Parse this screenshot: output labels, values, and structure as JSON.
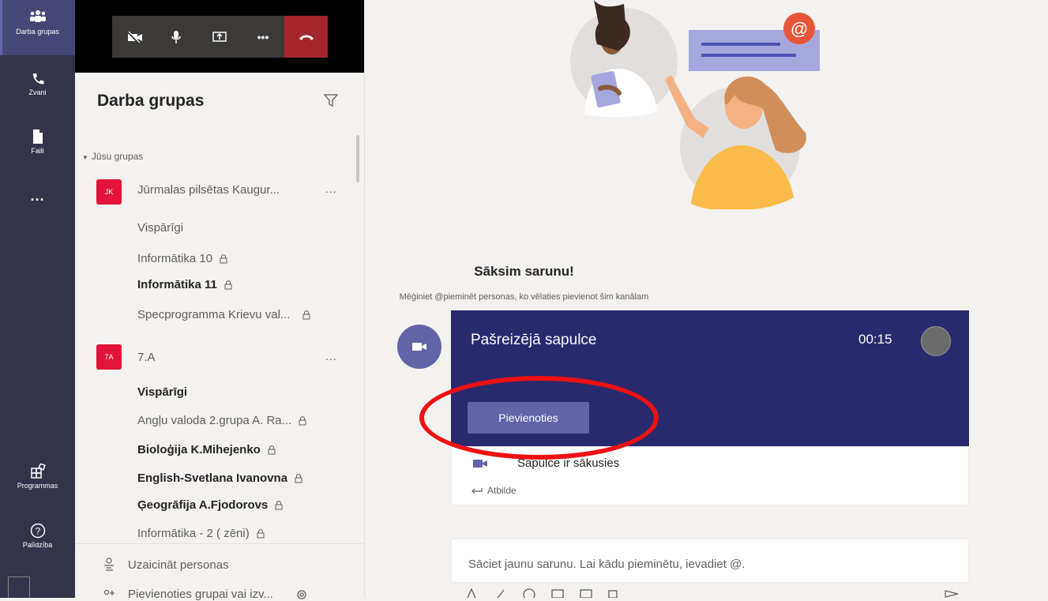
{
  "rail": {
    "items": [
      {
        "label": "Darba grupas",
        "icon": "teams-icon"
      },
      {
        "label": "Zvani",
        "icon": "phone-icon"
      },
      {
        "label": "Faili",
        "icon": "file-icon"
      },
      {
        "label": "...",
        "icon": "more-icon"
      },
      {
        "label": "Programmas",
        "icon": "apps-icon"
      },
      {
        "label": "Palīdzība",
        "icon": "help-icon"
      }
    ]
  },
  "panel": {
    "title": "Darba grupas",
    "section_label": "Jūsu grupas",
    "teams": [
      {
        "tile": "JK",
        "name": "Jūrmalas pilsētas Kaugur...",
        "more": "...",
        "channels": [
          {
            "label": "Vispārīgi",
            "bold": false,
            "locked": false
          },
          {
            "label": "Informātika 10",
            "bold": false,
            "locked": true
          },
          {
            "label": "Informātika 11",
            "bold": true,
            "locked": true
          },
          {
            "label": "Specprogramma Krievu val...",
            "bold": false,
            "locked": true
          }
        ]
      },
      {
        "tile": "7A",
        "name": "7.A",
        "more": "...",
        "channels": [
          {
            "label": "Vispārīgi",
            "bold": true,
            "locked": false
          },
          {
            "label": "Angļu valoda 2.grupa A. Ra...",
            "bold": false,
            "locked": true
          },
          {
            "label": "Bioloģija K.Mihejenko",
            "bold": true,
            "locked": true
          },
          {
            "label": "English-Svetlana Ivanovna",
            "bold": true,
            "locked": true
          },
          {
            "label": "Ģeogrāfija A.Fjodorovs",
            "bold": true,
            "locked": true
          },
          {
            "label": "Informātika - 2 ( zēni)",
            "bold": false,
            "locked": true
          }
        ]
      }
    ],
    "invite_label": "Uzaicināt personas",
    "join_team_label": "Pievienoties grupai vai izv..."
  },
  "main": {
    "hero_title": "Sāksim sarunu!",
    "hero_subtitle": "Mēģiniet @pieminēt personas, ko vēlaties pievienot šim kanālam",
    "meeting": {
      "title": "Pašreizējā sapulce",
      "time": "00:15",
      "join_label": "Pievienoties",
      "started_text": "Sapulce ir sākusies",
      "reply_label": "Atbilde"
    },
    "composer_placeholder": "Sāciet jaunu sarunu. Lai kādu pieminētu, ievadiet @."
  },
  "colors": {
    "rail": "#33344a",
    "accent": "#6264a7",
    "meeting_card": "#292a6d",
    "hangup": "#a4262c",
    "annotation": "#ee1111",
    "team_tile": "#e3143c"
  }
}
